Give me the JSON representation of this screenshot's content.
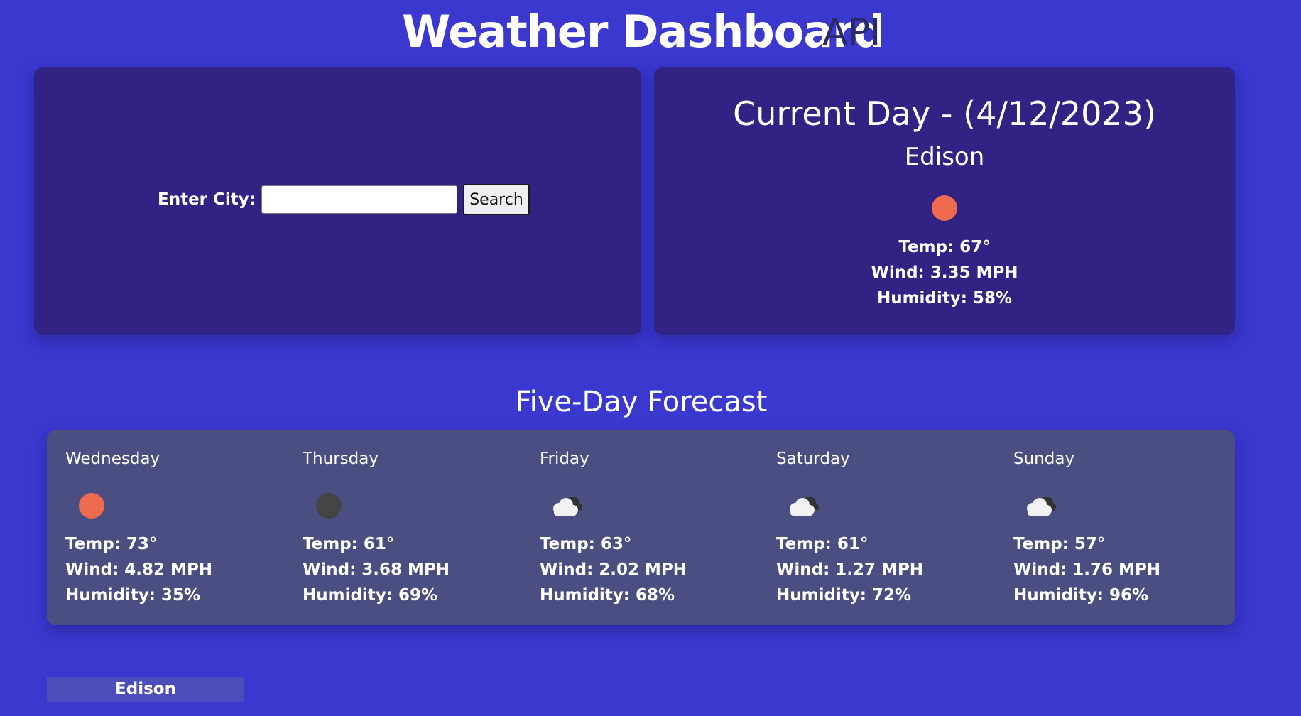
{
  "header": {
    "title": "Weather Dashboard",
    "api_label": "API"
  },
  "search": {
    "label": "Enter City:",
    "input_value": "",
    "button_label": "Search"
  },
  "current": {
    "title": "Current Day - (4/12/2023)",
    "city": "Edison",
    "icon": "sun-icon",
    "temp": "Temp: 67°",
    "wind": "Wind: 3.35 MPH",
    "humidity": "Humidity: 58%"
  },
  "forecast": {
    "heading": "Five-Day Forecast",
    "days": [
      {
        "name": "Wednesday",
        "icon": "sun-icon",
        "temp": "Temp: 73°",
        "wind": "Wind: 4.82 MPH",
        "humidity": "Humidity: 35%"
      },
      {
        "name": "Thursday",
        "icon": "dark-circle-icon",
        "temp": "Temp: 61°",
        "wind": "Wind: 3.68 MPH",
        "humidity": "Humidity: 69%"
      },
      {
        "name": "Friday",
        "icon": "cloud-icon",
        "temp": "Temp: 63°",
        "wind": "Wind: 2.02 MPH",
        "humidity": "Humidity: 68%"
      },
      {
        "name": "Saturday",
        "icon": "cloud-icon",
        "temp": "Temp: 61°",
        "wind": "Wind: 1.27 MPH",
        "humidity": "Humidity: 72%"
      },
      {
        "name": "Sunday",
        "icon": "cloud-icon",
        "temp": "Temp: 57°",
        "wind": "Wind: 1.76 MPH",
        "humidity": "Humidity: 96%"
      }
    ]
  },
  "history": {
    "items": [
      "Edison"
    ]
  },
  "colors": {
    "background": "#3a38cf",
    "card": "#322283",
    "forecast_card": "#4b4e80",
    "sun": "#ee6b4e",
    "api_label": "#2a2a66"
  }
}
